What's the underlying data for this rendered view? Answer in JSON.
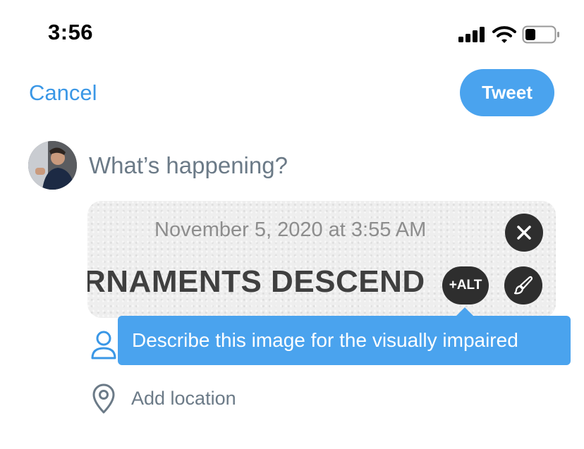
{
  "status_bar": {
    "time": "3:56"
  },
  "nav": {
    "cancel_label": "Cancel",
    "tweet_label": "Tweet"
  },
  "composer": {
    "placeholder": "What’s happening?"
  },
  "attachment": {
    "date_text": "November 5, 2020 at 3:55 AM",
    "headline_text": "RNAMENTS DESCEND",
    "alt_label": "+ALT"
  },
  "tooltip": {
    "text": "Describe this image for the visually impaired"
  },
  "location": {
    "label": "Add location"
  },
  "colors": {
    "accent": "#4aa3ee",
    "link": "#3a97e6",
    "placeholder": "#6b7a87",
    "dark_button": "#2e2e2e"
  },
  "icons": {
    "signal": "cellular-signal-icon",
    "wifi": "wifi-icon",
    "battery": "battery-icon",
    "close": "close-icon",
    "brush": "brush-icon",
    "person": "person-icon",
    "location": "location-pin-icon"
  }
}
